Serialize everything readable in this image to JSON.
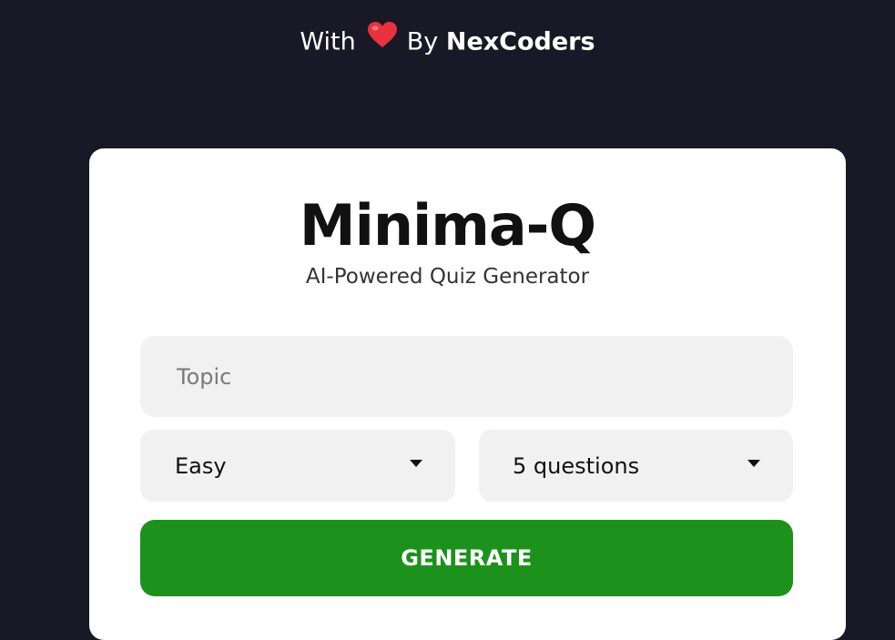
{
  "credit": {
    "prefix": "With",
    "middle": "By",
    "brand": "NexCoders",
    "icon": "heart-icon",
    "heart_color": "#e8323e"
  },
  "app": {
    "title": "Minima-Q",
    "subtitle": "AI-Powered Quiz Generator"
  },
  "form": {
    "topic_placeholder": "Topic",
    "topic_value": "",
    "difficulty_selected": "Easy",
    "question_count_selected": "5 questions",
    "dropdown_icon": "caret-down-icon",
    "generate_label": "GENERATE"
  },
  "colors": {
    "background": "#181826",
    "card": "#ffffff",
    "field": "#f1f1f1",
    "accent": "#1c921c"
  }
}
